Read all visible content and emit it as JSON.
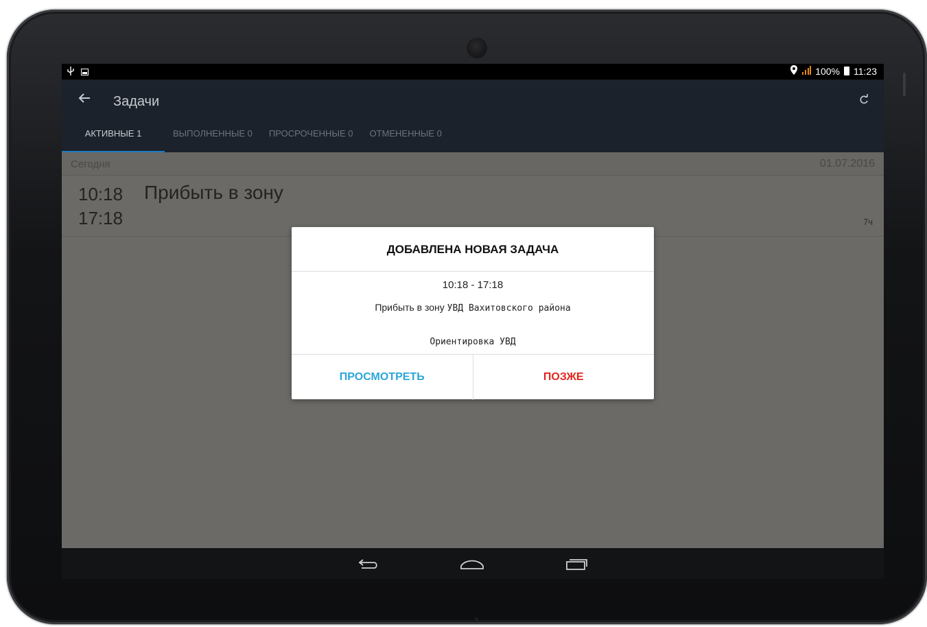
{
  "statusbar": {
    "left_icons": [
      "usb-icon",
      "image-icon"
    ],
    "battery_percent": "100%",
    "time": "11:23"
  },
  "appbar": {
    "title": "Задачи"
  },
  "tabs": [
    {
      "label": "АКТИВНЫЕ 1",
      "active": true
    },
    {
      "label": "ВЫПОЛНЕННЫЕ 0",
      "active": false
    },
    {
      "label": "ПРОСРОЧЕННЫЕ 0",
      "active": false
    },
    {
      "label": "ОТМЕНЕННЫЕ 0",
      "active": false
    }
  ],
  "section": {
    "label": "Сегодня",
    "date": "01.07.2016"
  },
  "task": {
    "start": "10:18",
    "end": "17:18",
    "title": "Прибыть в зону",
    "duration": "7ч"
  },
  "dialog": {
    "title": "ДОБАВЛЕНА НОВАЯ ЗАДАЧА",
    "time_range": "10:18 - 17:18",
    "message_prefix": "Прибыть в зону",
    "message_detail": "УВД Вахитовского района",
    "note": "Ориентировка УВД",
    "view_label": "ПРОСМОТРЕТЬ",
    "later_label": "ПОЗЖЕ"
  },
  "colors": {
    "accent_blue": "#2aa6d8",
    "accent_red": "#e1261c",
    "tab_indicator": "#1a7fc8",
    "appbar_bg": "#1c222b"
  }
}
